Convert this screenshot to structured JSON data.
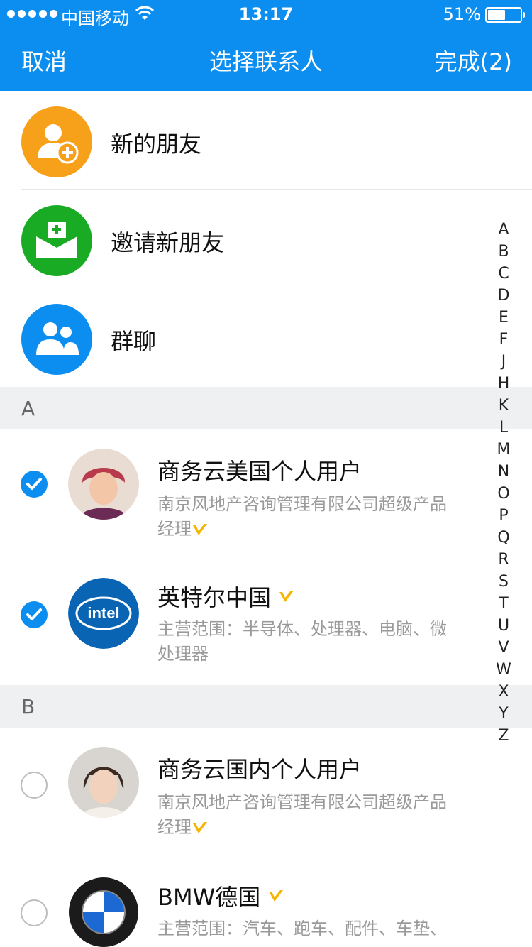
{
  "status_bar": {
    "carrier": "中国移动",
    "time": "13:17",
    "battery": "51%",
    "battery_level": 0.51
  },
  "nav": {
    "cancel": "取消",
    "title": "选择联系人",
    "done": "完成(2)"
  },
  "quick_actions": [
    {
      "label": "新的朋友",
      "icon": "add-user-icon",
      "color": "#f7a01a"
    },
    {
      "label": "邀请新朋友",
      "icon": "invite-envelope-icon",
      "color": "#1aab25"
    },
    {
      "label": "群聊",
      "icon": "group-icon",
      "color": "#0b8ef0"
    }
  ],
  "sections": [
    {
      "letter": "A"
    },
    {
      "letter": "B"
    }
  ],
  "contacts": [
    {
      "name": "商务云美国个人用户",
      "desc": "南京风地产咨询管理有限公司超级产品经理",
      "selected": true,
      "verified": true
    },
    {
      "name": "英特尔中国",
      "desc": "主营范围：半导体、处理器、电脑、微处理器",
      "selected": true,
      "verified": true
    },
    {
      "name": "商务云国内个人用户",
      "desc": "南京风地产咨询管理有限公司超级产品经理",
      "selected": false,
      "verified": true
    },
    {
      "name": "BMW德国",
      "desc": "主营范围：汽车、跑车、配件、车垫、",
      "selected": false,
      "verified": true
    }
  ],
  "index_letters": [
    "A",
    "B",
    "C",
    "D",
    "E",
    "F",
    "J",
    "H",
    "K",
    "L",
    "M",
    "N",
    "O",
    "P",
    "Q",
    "R",
    "S",
    "T",
    "U",
    "V",
    "W",
    "X",
    "Y",
    "Z"
  ],
  "colors": {
    "accent": "#0b8ef0",
    "verified": "#f5b400"
  }
}
